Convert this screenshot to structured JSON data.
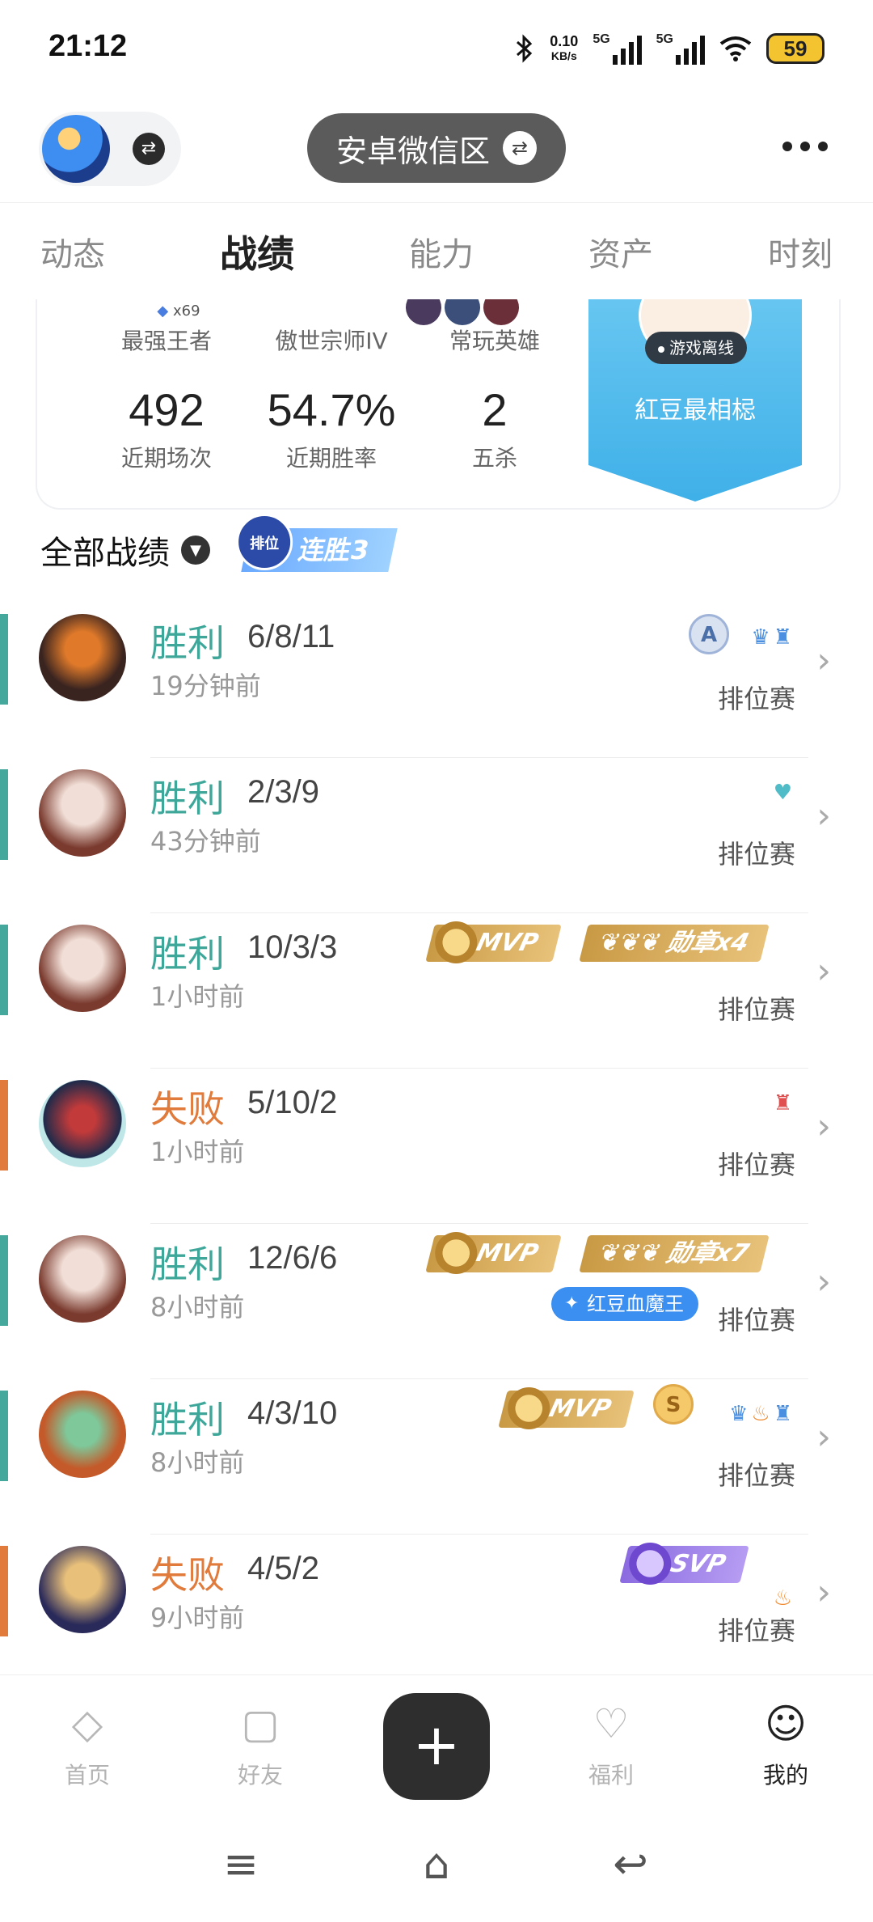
{
  "status_bar": {
    "time": "21:12",
    "net_speed_value": "0.10",
    "net_speed_unit": "KB/s",
    "signal1": "5G",
    "signal2": "5G",
    "battery": "59"
  },
  "header": {
    "zone_label": "安卓微信区"
  },
  "tabs": [
    {
      "label": "动态"
    },
    {
      "label": "战绩"
    },
    {
      "label": "能力"
    },
    {
      "label": "资产"
    },
    {
      "label": "时刻"
    }
  ],
  "summary": {
    "rank_star_count": "x69",
    "rank_label": "最强王者",
    "tier_label": "傲世宗师IV",
    "heroes_label": "常玩英雄",
    "stats": [
      {
        "value": "492",
        "label": "近期场次"
      },
      {
        "value": "54.7%",
        "label": "近期胜率"
      },
      {
        "value": "2",
        "label": "五杀"
      }
    ],
    "banner": {
      "status": "游戏离线",
      "title": "紅豆最相梞"
    }
  },
  "section": {
    "title": "全部战绩",
    "streak_tag": "排位",
    "streak_label": "连胜3"
  },
  "matches": [
    {
      "result": "胜利",
      "outcome": "win",
      "kda": "6/8/11",
      "time": "19分钟前",
      "mode": "排位赛",
      "rank_coin": "A"
    },
    {
      "result": "胜利",
      "outcome": "win",
      "kda": "2/3/9",
      "time": "43分钟前",
      "mode": "排位赛"
    },
    {
      "result": "胜利",
      "outcome": "win",
      "kda": "10/3/3",
      "time": "1小时前",
      "mode": "排位赛",
      "mvp": "MVP",
      "medal": "勋章x4"
    },
    {
      "result": "失败",
      "outcome": "loss",
      "kda": "5/10/2",
      "time": "1小时前",
      "mode": "排位赛"
    },
    {
      "result": "胜利",
      "outcome": "win",
      "kda": "12/6/6",
      "time": "8小时前",
      "mode": "排位赛",
      "mvp": "MVP",
      "medal": "勋章x7",
      "hero_title": "红豆血魔王"
    },
    {
      "result": "胜利",
      "outcome": "win",
      "kda": "4/3/10",
      "time": "8小时前",
      "mode": "排位赛",
      "mvp": "MVP",
      "rank_coin": "S"
    },
    {
      "result": "失败",
      "outcome": "loss",
      "kda": "4/5/2",
      "time": "9小时前",
      "mode": "排位赛",
      "svp": "SVP"
    }
  ],
  "bottom_nav": [
    {
      "label": "首页"
    },
    {
      "label": "好友"
    },
    {
      "label": "福利"
    },
    {
      "label": "我的"
    }
  ],
  "colors": {
    "win": "#3ea79a",
    "loss": "#e07b3c",
    "banner": "#4db6ec"
  },
  "icons": {
    "bluetooth": "bluetooth-icon",
    "wifi": "wifi-icon",
    "switch": "swap-icon",
    "more": "more-dots-icon",
    "chevron": "chevron-right-icon"
  }
}
